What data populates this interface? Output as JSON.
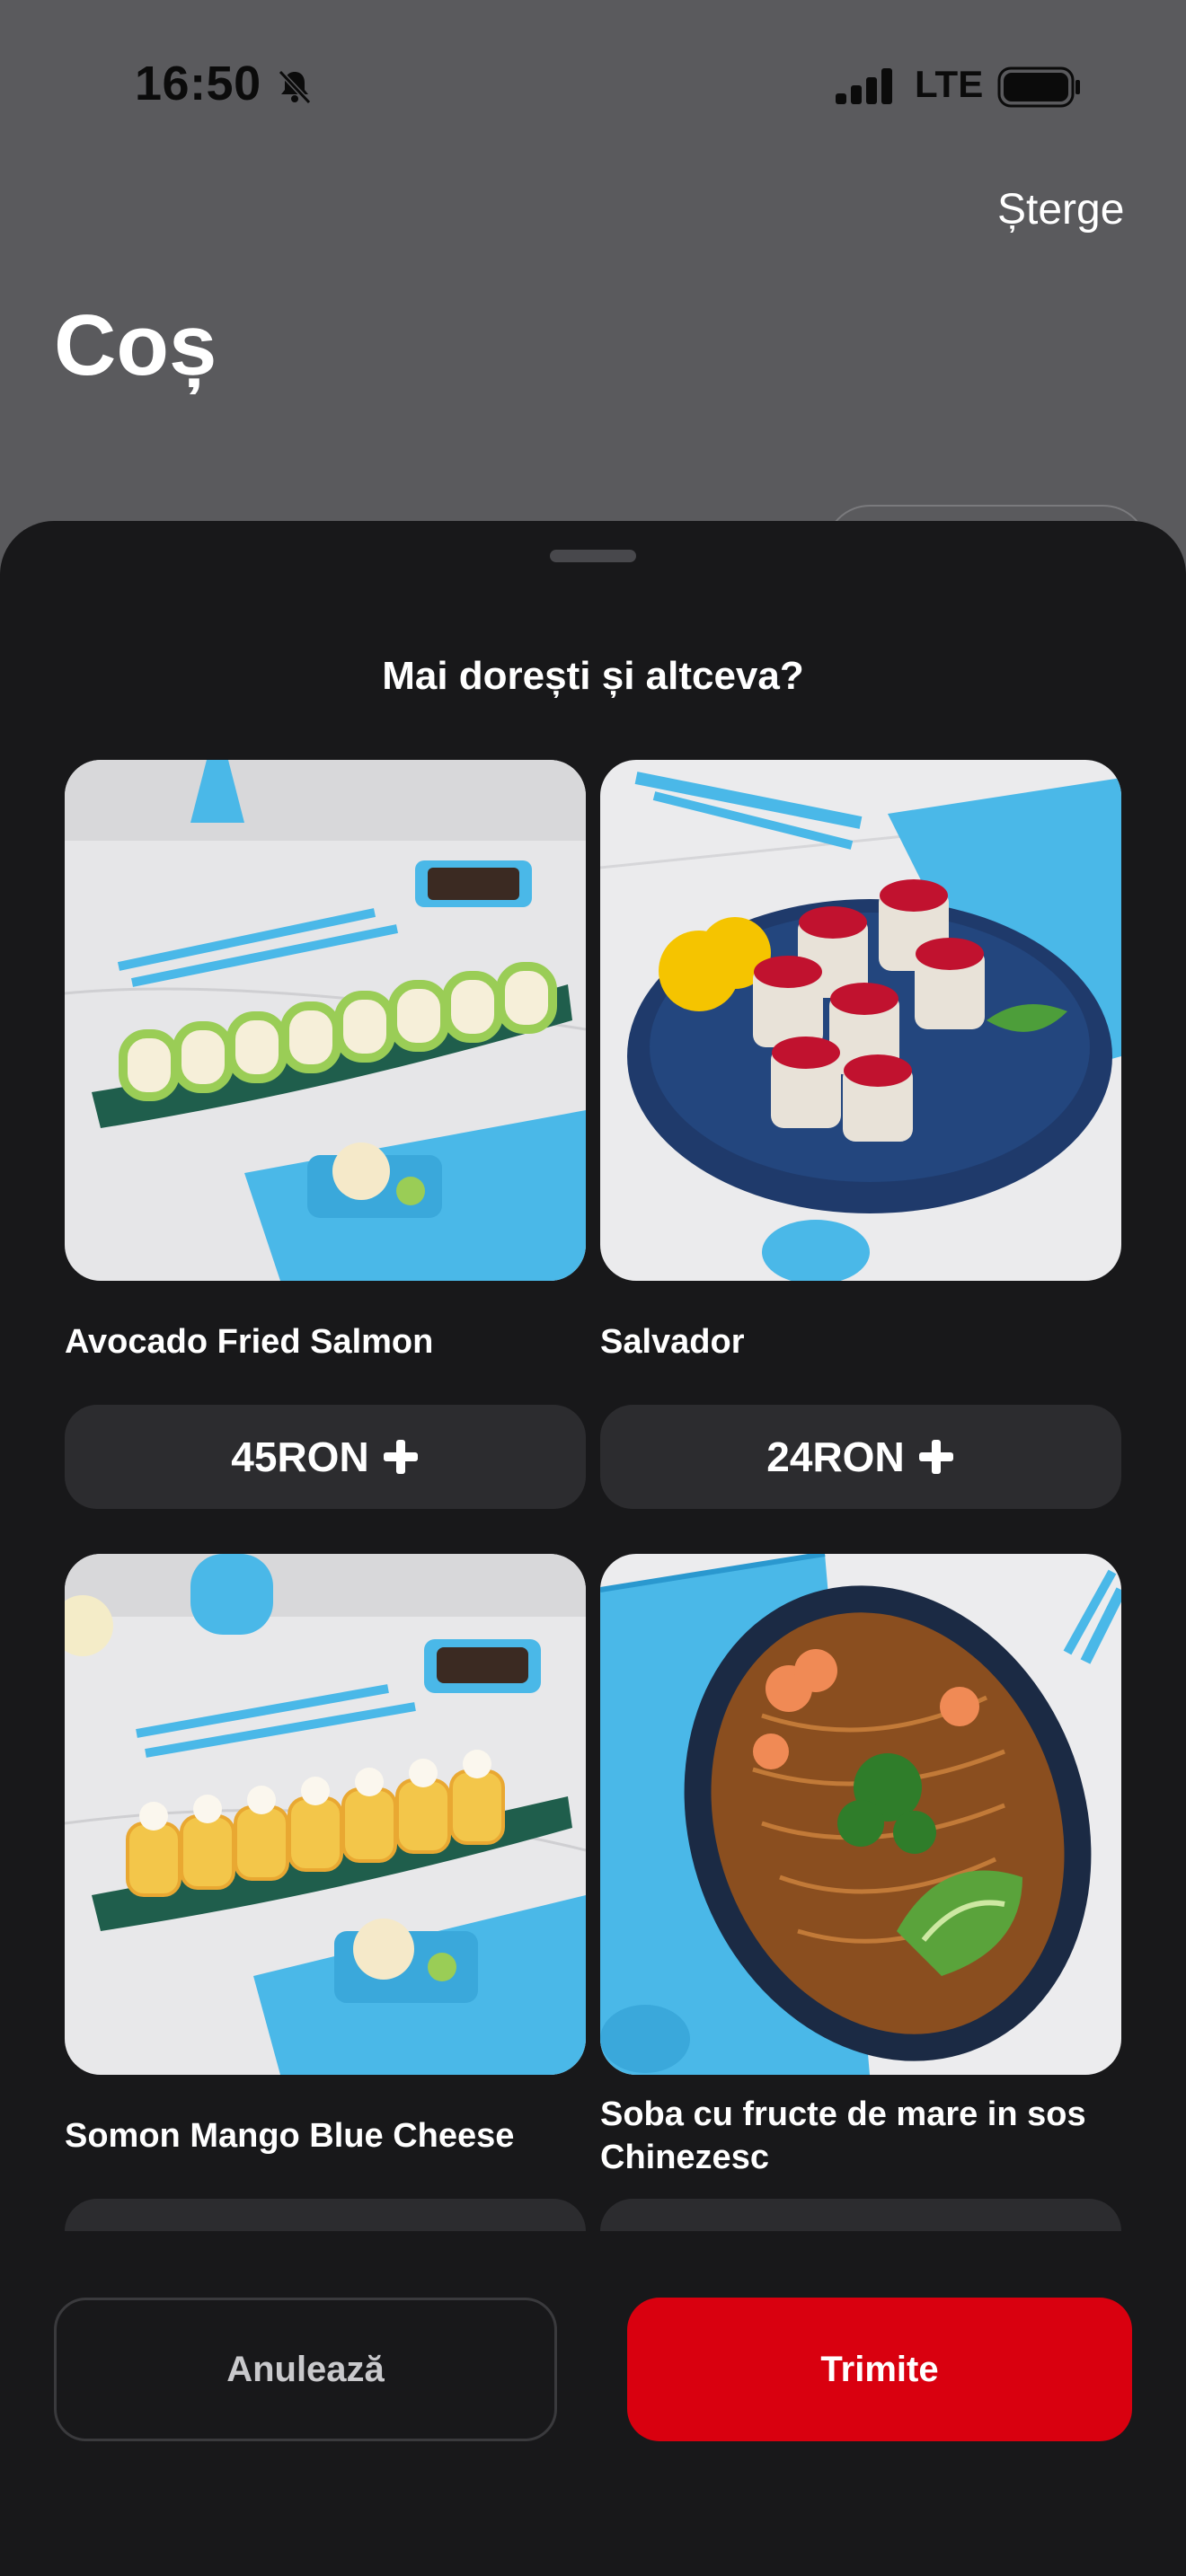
{
  "status_bar": {
    "time": "16:50",
    "network": "LTE"
  },
  "header": {
    "delete_label": "Șterge",
    "title": "Coș"
  },
  "sheet": {
    "title": "Mai dorești și altceva?",
    "products": [
      {
        "name": "Avocado Fried Salmon",
        "price": "45RON"
      },
      {
        "name": "Salvador",
        "price": "24RON"
      },
      {
        "name": "Somon Mango Blue Cheese",
        "price": ""
      },
      {
        "name": "Soba cu fructe de mare in sos Chinezesc",
        "price": ""
      }
    ]
  },
  "actions": {
    "cancel_label": "Anulează",
    "send_label": "Trimite"
  },
  "colors": {
    "accent": "#d9000f",
    "sheet_bg": "#18181a",
    "backdrop": "#5a5a5d",
    "button_bg": "#2c2c2f",
    "plate_blue": "#4ab8e8"
  }
}
